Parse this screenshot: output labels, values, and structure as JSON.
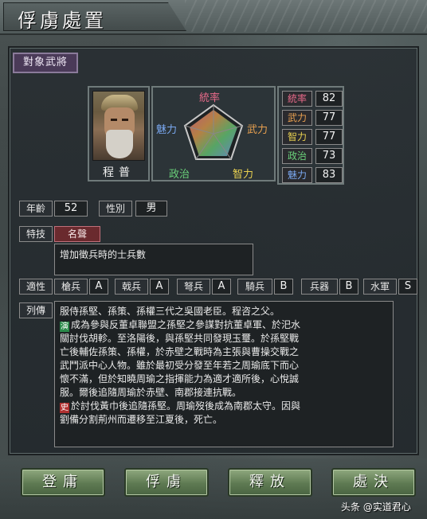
{
  "window": {
    "title": "俘虜處置"
  },
  "target_tag": "對象武將",
  "general": {
    "name": "程普",
    "radar_labels": {
      "top": "統率",
      "right": "武力",
      "bottom_right": "智力",
      "bottom_left": "政治",
      "left": "魅力"
    },
    "stats": [
      {
        "label": "統率",
        "value": "82",
        "color": "#e86a8a"
      },
      {
        "label": "武力",
        "value": "77",
        "color": "#e8a050"
      },
      {
        "label": "智力",
        "value": "77",
        "color": "#e8d050"
      },
      {
        "label": "政治",
        "value": "73",
        "color": "#6ad07a"
      },
      {
        "label": "魅力",
        "value": "83",
        "color": "#7aa8f0"
      }
    ],
    "age_label": "年齡",
    "age": "52",
    "gender_label": "性別",
    "gender": "男",
    "skill_label": "特技",
    "skill_name": "名聲",
    "skill_desc": "增加徵兵時的士兵數",
    "aptitude_label": "適性",
    "aptitudes": [
      {
        "label": "槍兵",
        "grade": "A"
      },
      {
        "label": "戟兵",
        "grade": "A"
      },
      {
        "label": "弩兵",
        "grade": "A"
      },
      {
        "label": "騎兵",
        "grade": "B"
      },
      {
        "label": "兵器",
        "grade": "B"
      },
      {
        "label": "水軍",
        "grade": "S"
      }
    ],
    "bio_label": "列傳",
    "bio_lines": [
      {
        "icon": "",
        "text": "服侍孫堅、孫策、孫權三代之吳國老臣。程咨之父。"
      },
      {
        "icon": "演",
        "text": "成為參與反董卓聯盟之孫堅之參謀對抗董卓軍、於汜水"
      },
      {
        "icon": "",
        "text": "關討伐胡軫。至洛陽後，與孫堅共同發現玉璽。於孫堅戰"
      },
      {
        "icon": "",
        "text": "亡後輔佐孫策、孫權，於赤壁之戰時為主張與曹操交戰之"
      },
      {
        "icon": "",
        "text": "武鬥派中心人物。雖於最初受分發至年若之周瑜底下而心"
      },
      {
        "icon": "",
        "text": "懷不滿，但於知曉周瑜之指揮能力為適才適所後，心悅誠"
      },
      {
        "icon": "",
        "text": "服。爾後追隨周瑜於赤壁、南郡接連抗戰。"
      },
      {
        "icon": "史",
        "text": "於討伐黃巾後追隨孫堅。周瑜歿後成為南郡太守。因與"
      },
      {
        "icon": "",
        "text": "劉備分割荊州而遷移至江夏後，死亡。"
      }
    ]
  },
  "actions": {
    "recruit": "登庸",
    "capture": "俘虜",
    "release": "釋放",
    "execute": "處決"
  },
  "watermark": "头条 @实道君心"
}
